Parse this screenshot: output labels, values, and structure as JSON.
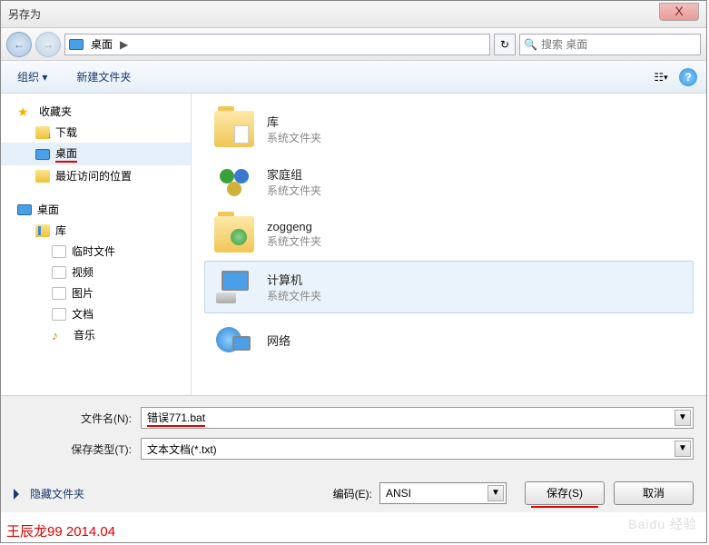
{
  "window": {
    "title": "另存为",
    "close": "X"
  },
  "nav": {
    "back_icon": "←",
    "fwd_icon": "→",
    "path_seg": "桌面",
    "arrow": "▶",
    "refresh_icon": "↻",
    "search_placeholder": "搜索 桌面",
    "search_icon": "🔍"
  },
  "toolbar": {
    "organize": "组织 ▾",
    "newfolder": "新建文件夹",
    "view_icon": "☷",
    "help_icon": "?"
  },
  "sidebar": {
    "favorites": "收藏夹",
    "downloads": "下载",
    "desktop": "桌面",
    "recent": "最近访问的位置",
    "desktop2": "桌面",
    "library": "库",
    "temp": "临时文件",
    "video": "视频",
    "pictures": "图片",
    "docs": "文档",
    "music": "音乐"
  },
  "content": {
    "items": [
      {
        "name": "库",
        "sub": "系统文件夹"
      },
      {
        "name": "家庭组",
        "sub": "系统文件夹"
      },
      {
        "name": "zoggeng",
        "sub": "系统文件夹"
      },
      {
        "name": "计算机",
        "sub": "系统文件夹"
      },
      {
        "name": "网络",
        "sub": ""
      }
    ]
  },
  "form": {
    "filename_label": "文件名(N):",
    "filename_value": "错误771.bat",
    "filetype_label": "保存类型(T):",
    "filetype_value": "文本文档(*.txt)",
    "encoding_label": "编码(E):",
    "encoding_value": "ANSI",
    "hide_folders": "隐藏文件夹",
    "save": "保存(S)",
    "cancel": "取消"
  },
  "watermark": "王辰龙99 2014.04",
  "baidu": "Baidu 经验"
}
